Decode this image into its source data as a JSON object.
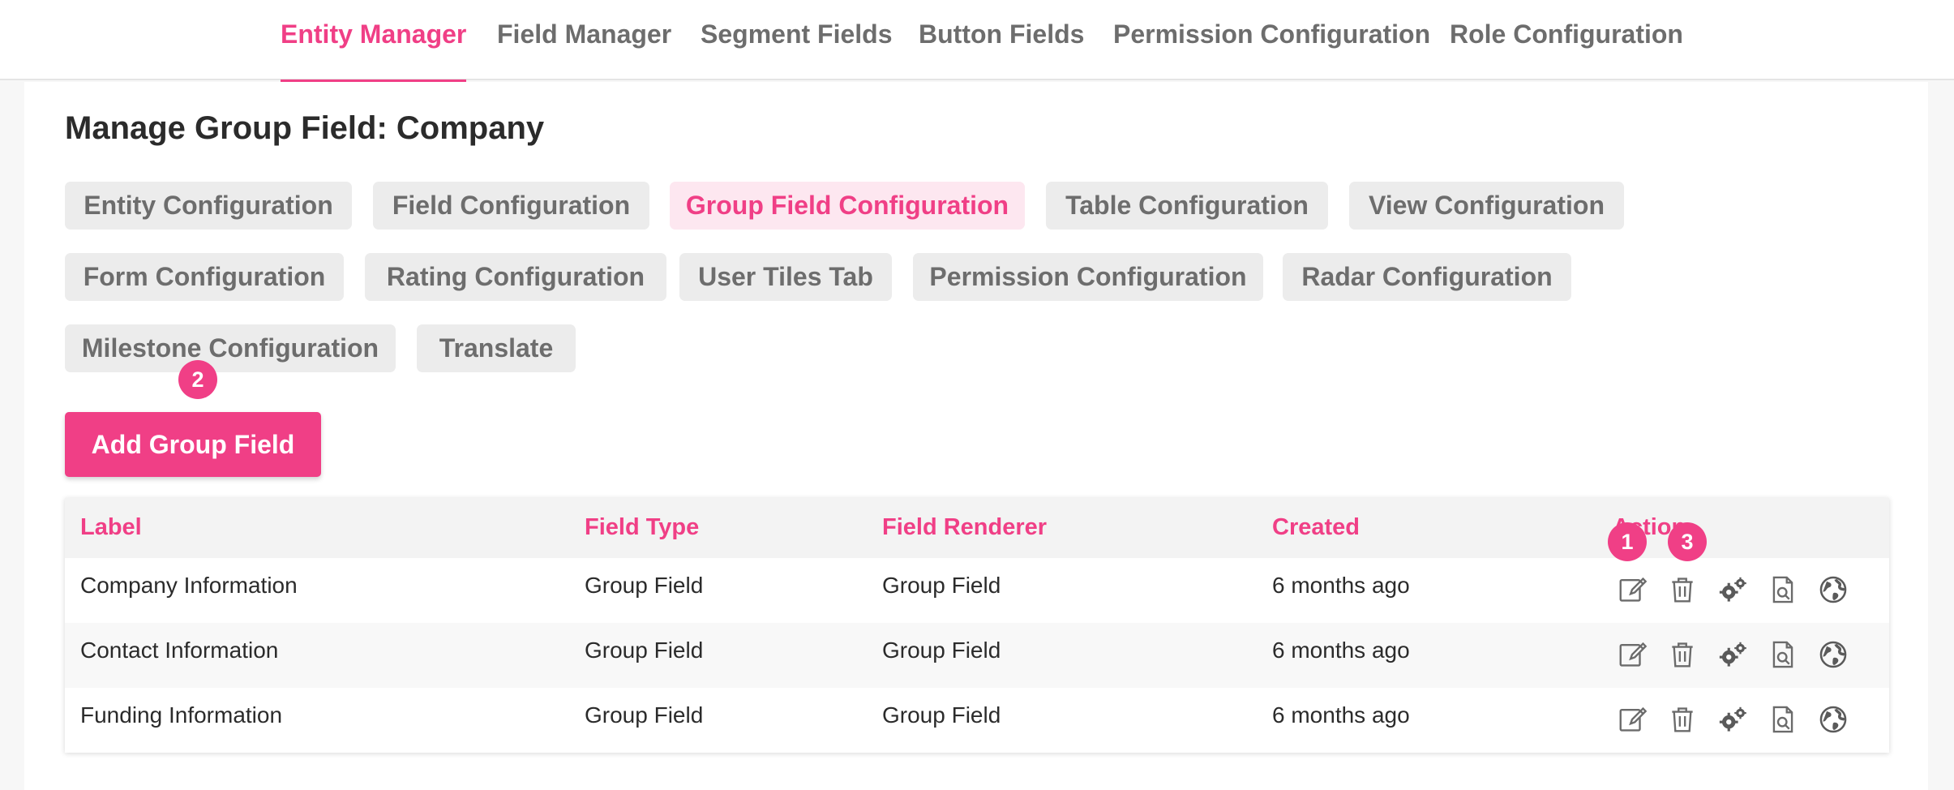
{
  "top_nav": {
    "tabs": [
      {
        "label": "Entity Manager",
        "active": true
      },
      {
        "label": "Field Manager",
        "active": false
      },
      {
        "label": "Segment Fields",
        "active": false
      },
      {
        "label": "Button Fields",
        "active": false
      },
      {
        "label": "Permission Configuration",
        "active": false
      },
      {
        "label": "Role Configuration",
        "active": false
      }
    ]
  },
  "page": {
    "title": "Manage Group Field: Company"
  },
  "config_tabs": [
    {
      "label": "Entity Configuration",
      "active": false
    },
    {
      "label": "Field Configuration",
      "active": false
    },
    {
      "label": "Group Field Configuration",
      "active": true
    },
    {
      "label": "Table Configuration",
      "active": false
    },
    {
      "label": "View Configuration",
      "active": false
    },
    {
      "label": "Form Configuration",
      "active": false
    },
    {
      "label": "Rating Configuration",
      "active": false
    },
    {
      "label": "User Tiles Tab",
      "active": false
    },
    {
      "label": "Permission Configuration",
      "active": false
    },
    {
      "label": "Radar Configuration",
      "active": false
    },
    {
      "label": "Milestone Configuration",
      "active": false
    },
    {
      "label": "Translate",
      "active": false
    }
  ],
  "add_button": {
    "label": "Add Group Field"
  },
  "badges": [
    "1",
    "2",
    "3"
  ],
  "table": {
    "headers": [
      "Label",
      "Field Type",
      "Field Renderer",
      "Created",
      "Action"
    ],
    "rows": [
      {
        "label": "Company Information",
        "field_type": "Group Field",
        "field_renderer": "Group Field",
        "created": "6 months ago"
      },
      {
        "label": "Contact Information",
        "field_type": "Group Field",
        "field_renderer": "Group Field",
        "created": "6 months ago"
      },
      {
        "label": "Funding Information",
        "field_type": "Group Field",
        "field_renderer": "Group Field",
        "created": "6 months ago"
      }
    ],
    "action_icons": [
      "edit-icon",
      "trash-icon",
      "gears-icon",
      "document-search-icon",
      "globe-icon"
    ]
  },
  "colors": {
    "accent": "#f03f86",
    "accent_light": "#fde7f0",
    "pill_bg": "#ececec",
    "muted_text": "#6d6d6d",
    "page_bg": "#f7f7f7"
  }
}
